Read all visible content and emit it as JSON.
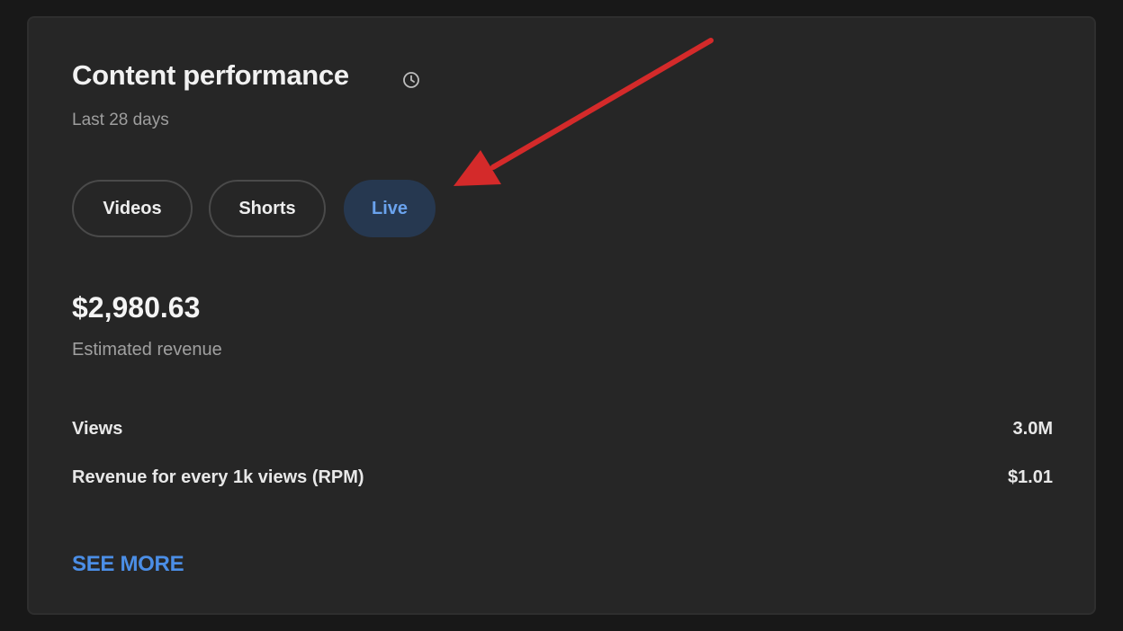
{
  "card": {
    "title": "Content performance",
    "title_icon": "history-clock-icon",
    "subtitle": "Last 28 days"
  },
  "tabs": [
    {
      "label": "Videos",
      "selected": false
    },
    {
      "label": "Shorts",
      "selected": false
    },
    {
      "label": "Live",
      "selected": true
    }
  ],
  "revenue": {
    "value": "$2,980.63",
    "label": "Estimated revenue"
  },
  "metrics": [
    {
      "label": "Views",
      "value": "3.0M"
    },
    {
      "label": "Revenue for every 1k views (RPM)",
      "value": "$1.01"
    }
  ],
  "see_more_label": "SEE MORE",
  "annotation": {
    "icon": "red-arrow-annotation",
    "color": "#d42a2a",
    "points_to": "Live"
  },
  "colors": {
    "background": "#181818",
    "card": "#262626",
    "accent": "#4b8ee6",
    "selected_tab_bg": "#263850",
    "selected_tab_text": "#6aa3ee"
  }
}
